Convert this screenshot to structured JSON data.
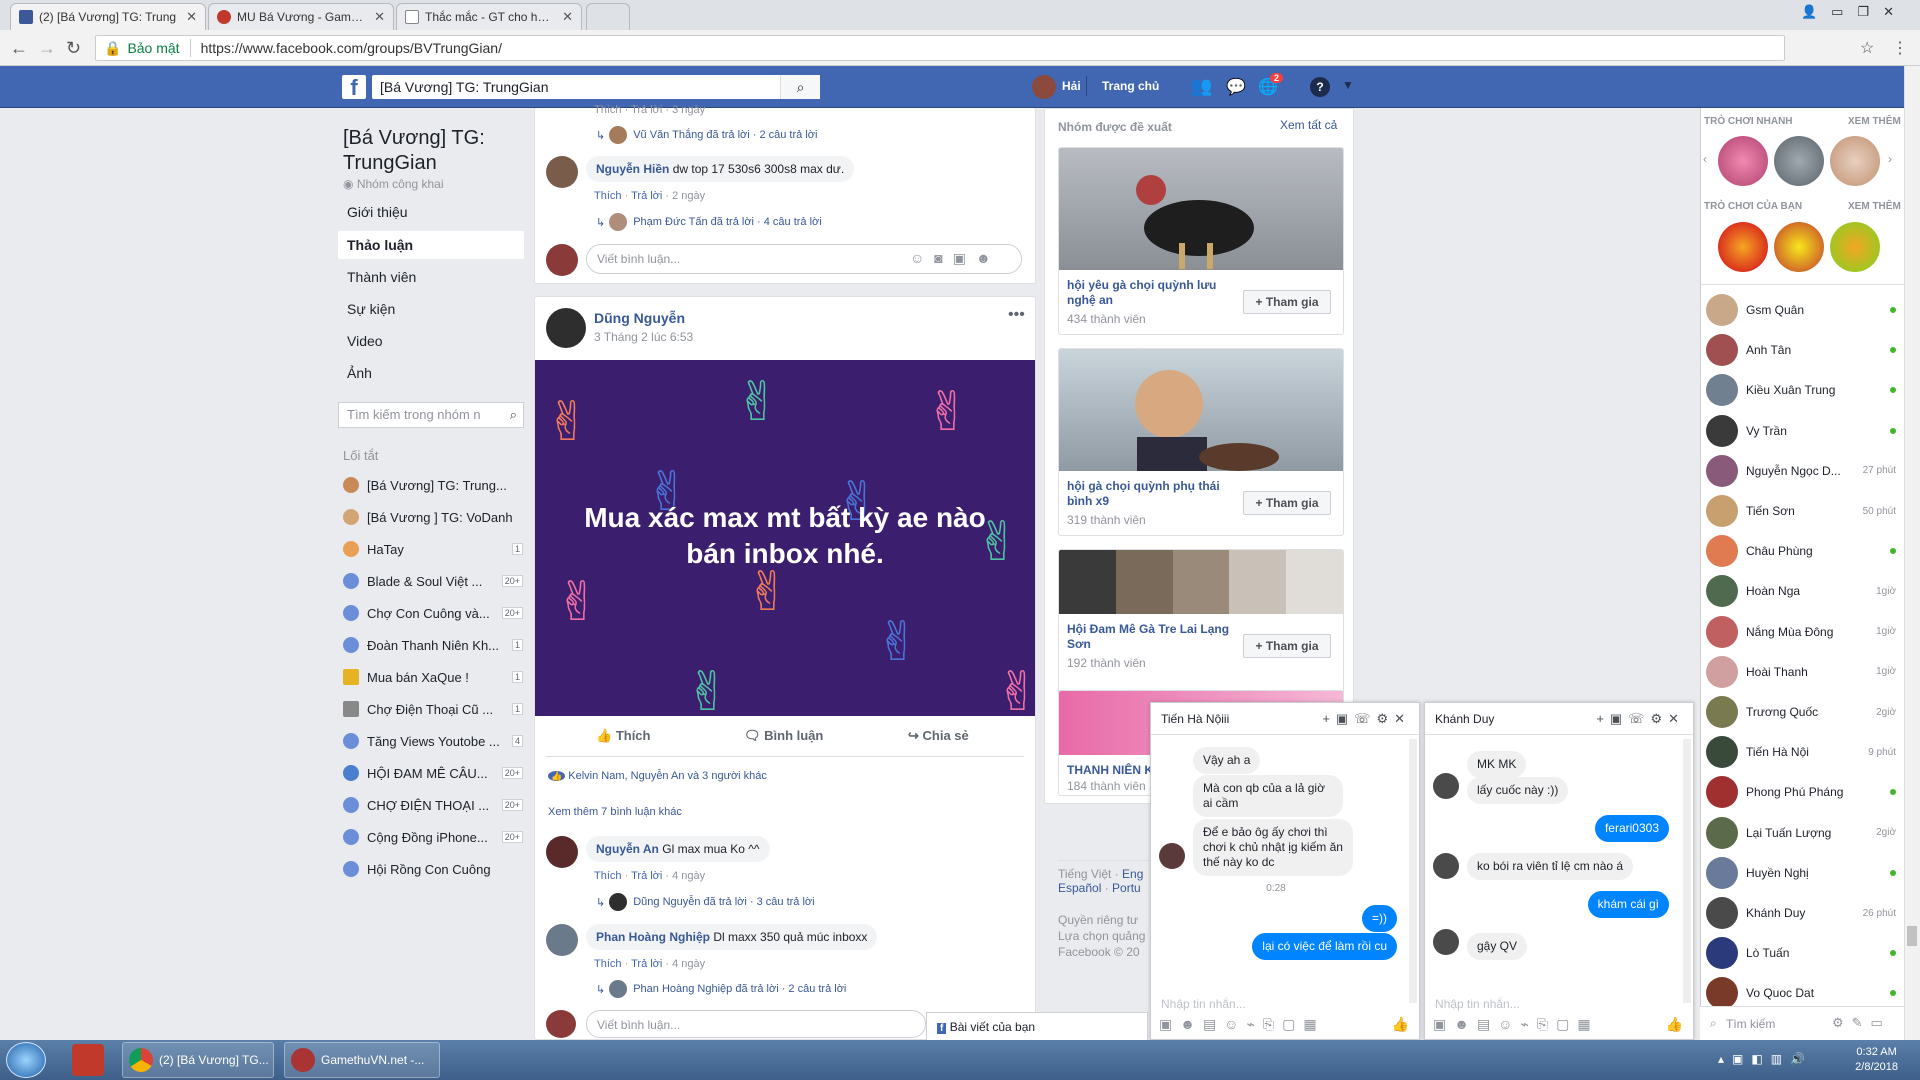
{
  "browser": {
    "tabs": [
      {
        "title": "(2) [Bá Vương] TG: Trung",
        "color": "#3b5998"
      },
      {
        "title": "MU Bá Vương - Gamethu",
        "color": "#c0392b"
      },
      {
        "title": "Thắc mắc - GT cho hỏi cá",
        "color": "#888888"
      }
    ],
    "secure_label": "Bảo mật",
    "url": "https://www.facebook.com/groups/BVTrungGian/"
  },
  "fb": {
    "search_value": "[Bá Vương] TG: TrungGian",
    "user_name": "Hải",
    "home_label": "Trang chủ",
    "notif_count": "2"
  },
  "group": {
    "title_line1": "[Bá Vương] TG:",
    "title_line2": "TrungGian",
    "type": "Nhóm công khai",
    "nav": [
      "Giới thiệu",
      "Thảo luận",
      "Thành viên",
      "Sự kiện",
      "Video",
      "Ảnh"
    ],
    "search_placeholder": "Tìm kiếm trong nhóm n",
    "shortcuts_title": "Lối tắt",
    "shortcuts": [
      {
        "name": "[Bá Vương] TG: Trung...",
        "badge": ""
      },
      {
        "name": "[Bá Vương ] TG: VoDanh",
        "badge": ""
      },
      {
        "name": "HaTay",
        "badge": "1"
      },
      {
        "name": "Blade & Soul Việt ...",
        "badge": "20+"
      },
      {
        "name": "Chợ Con Cuông và...",
        "badge": "20+"
      },
      {
        "name": "Đoàn Thanh Niên Kh...",
        "badge": "1"
      },
      {
        "name": "Mua bán XaQue !",
        "badge": "1"
      },
      {
        "name": "Chợ Điện Thoại Cũ ...",
        "badge": "1"
      },
      {
        "name": "Tăng Views Youtobe ...",
        "badge": "4"
      },
      {
        "name": "HỘI ĐAM MÊ CÂU...",
        "badge": "20+"
      },
      {
        "name": "CHỢ ĐIỆN THOẠI ...",
        "badge": "20+"
      },
      {
        "name": "Cộng Đồng iPhone...",
        "badge": "20+"
      },
      {
        "name": "Hội Rồng Con Cuông",
        "badge": ""
      }
    ]
  },
  "feed": {
    "top_partial": "Thích · Trả lời · 3 ngày",
    "top_reply": "Vũ Văn Thắng đã trả lời · 2 câu trả lời",
    "c1_name": "Nguyễn Hiền",
    "c1_text": "dw top 17 530s6 300s8 max dư.",
    "c1_meta_like": "Thích",
    "c1_meta_reply": "Trả lời",
    "c1_meta_time": "2 ngày",
    "c1_reply": "Phạm Đức Tấn đã trả lời · 4 câu trả lời",
    "write_placeholder": "Viết bình luận...",
    "post_author": "Dũng Nguyễn",
    "post_time": "3 Tháng 2 lúc 6:53",
    "post_text_line1": "Mua xác max mt bất kỳ ae nào",
    "post_text_line2": "bán inbox nhé.",
    "like_label": "Thích",
    "comment_label": "Bình luận",
    "share_label": "Chia sẻ",
    "reactions": "Kelvin Nam, Nguyễn An và 3 người khác",
    "more_comments": "Xem thêm 7 bình luận khác",
    "c2_name": "Nguyễn An",
    "c2_text": "Gl max mua Ko ^^",
    "c2_time": "4 ngày",
    "c2_reply": "Dũng Nguyễn đã trả lời · 3 câu trả lời",
    "c3_name": "Phan Hoàng Nghiệp",
    "c3_text": "Dl maxx 350 quả múc inboxx",
    "c3_time": "4 ngày",
    "c3_reply": "Phan Hoàng Nghiệp đã trả lời · 2 câu trả lời",
    "your_posts": "Bài viết của bạn"
  },
  "suggested": {
    "title": "Nhóm được đề xuất",
    "see_all": "Xem tất cả",
    "join_label": "+ Tham gia",
    "groups": [
      {
        "name1": "hội yêu gà chọi quỳnh lưu",
        "name2": "nghệ an",
        "members": "434 thành viên"
      },
      {
        "name1": "hội gà chọi quỳnh phụ thái",
        "name2": "bình x9",
        "members": "319 thành viên"
      },
      {
        "name1": "Hội Đam Mê Gà Tre Lai Lạng",
        "name2": "Sơn",
        "members": "192 thành viên"
      },
      {
        "name1": "THANH NIÊN K",
        "name2": "",
        "members": "184 thành viên"
      }
    ],
    "footer_lang1": "Tiếng Việt",
    "footer_lang2": "Eng",
    "footer_lang3": "Español",
    "footer_lang4": "Portu",
    "footer_privacy": "Quyền riêng tư",
    "footer_ads": "Lựa chọn quảng",
    "footer_copy": "Facebook © 20"
  },
  "chat": {
    "quick_games": "TRÒ CHƠI NHANH",
    "your_games": "TRÒ CHƠI CỦA BẠN",
    "see_more": "XEM THÊM",
    "search_placeholder": "Tìm kiếm",
    "contacts": [
      {
        "name": "Gsm Quân",
        "time": ""
      },
      {
        "name": "Anh Tân",
        "time": ""
      },
      {
        "name": "Kiều Xuân Trung",
        "time": ""
      },
      {
        "name": "Vy Trần",
        "time": ""
      },
      {
        "name": "Nguyễn Ngọc D...",
        "time": "27 phút"
      },
      {
        "name": "Tiến Sơn",
        "time": "50 phút"
      },
      {
        "name": "Châu Phùng",
        "time": ""
      },
      {
        "name": "Hoàn Nga",
        "time": "1giờ"
      },
      {
        "name": "Nắng Mùa Đông",
        "time": "1giờ"
      },
      {
        "name": "Hoài Thanh",
        "time": "1giờ"
      },
      {
        "name": "Trương Quốc",
        "time": "2giờ"
      },
      {
        "name": "Tiến Hà Nội",
        "time": "9 phút"
      },
      {
        "name": "Phong Phú Pháng",
        "time": ""
      },
      {
        "name": "Lại Tuấn Lượng",
        "time": "2giờ"
      },
      {
        "name": "Huyền Nghị",
        "time": ""
      },
      {
        "name": "Khánh Duy",
        "time": "26 phút"
      },
      {
        "name": "Lò Tuấn",
        "time": ""
      },
      {
        "name": "Vo Quoc Dat",
        "time": ""
      }
    ]
  },
  "chatwin1": {
    "title": "Tiến Hà Nộiii",
    "m1": "Vậy ah a",
    "m2": "Mà con qb của a lả giờ ai cầm",
    "m3": "Để e bảo ôg ấy chơi thì chơi k chủ nhật ịg kiếm ăn thế này ko dc",
    "time": "0:28",
    "m4": "=))",
    "m5": "lại có việc để làm rồi cu",
    "input_placeholder": "Nhập tin nhắn..."
  },
  "chatwin2": {
    "title": "Khánh Duy",
    "m1": "MK MK",
    "m2": "lấy cuốc này :))",
    "m3": "ferari0303",
    "m4": "ko bói ra viên tỉ lệ cm nào á",
    "m5": "khám cái gì",
    "m6": "gậy QV",
    "input_placeholder": "Nhập tin nhắn..."
  },
  "taskbar": {
    "app1": "(2) [Bá Vương] TG...",
    "app2": "GamethuVN.net -...",
    "time": "0:32 AM",
    "date": "2/8/2018"
  }
}
